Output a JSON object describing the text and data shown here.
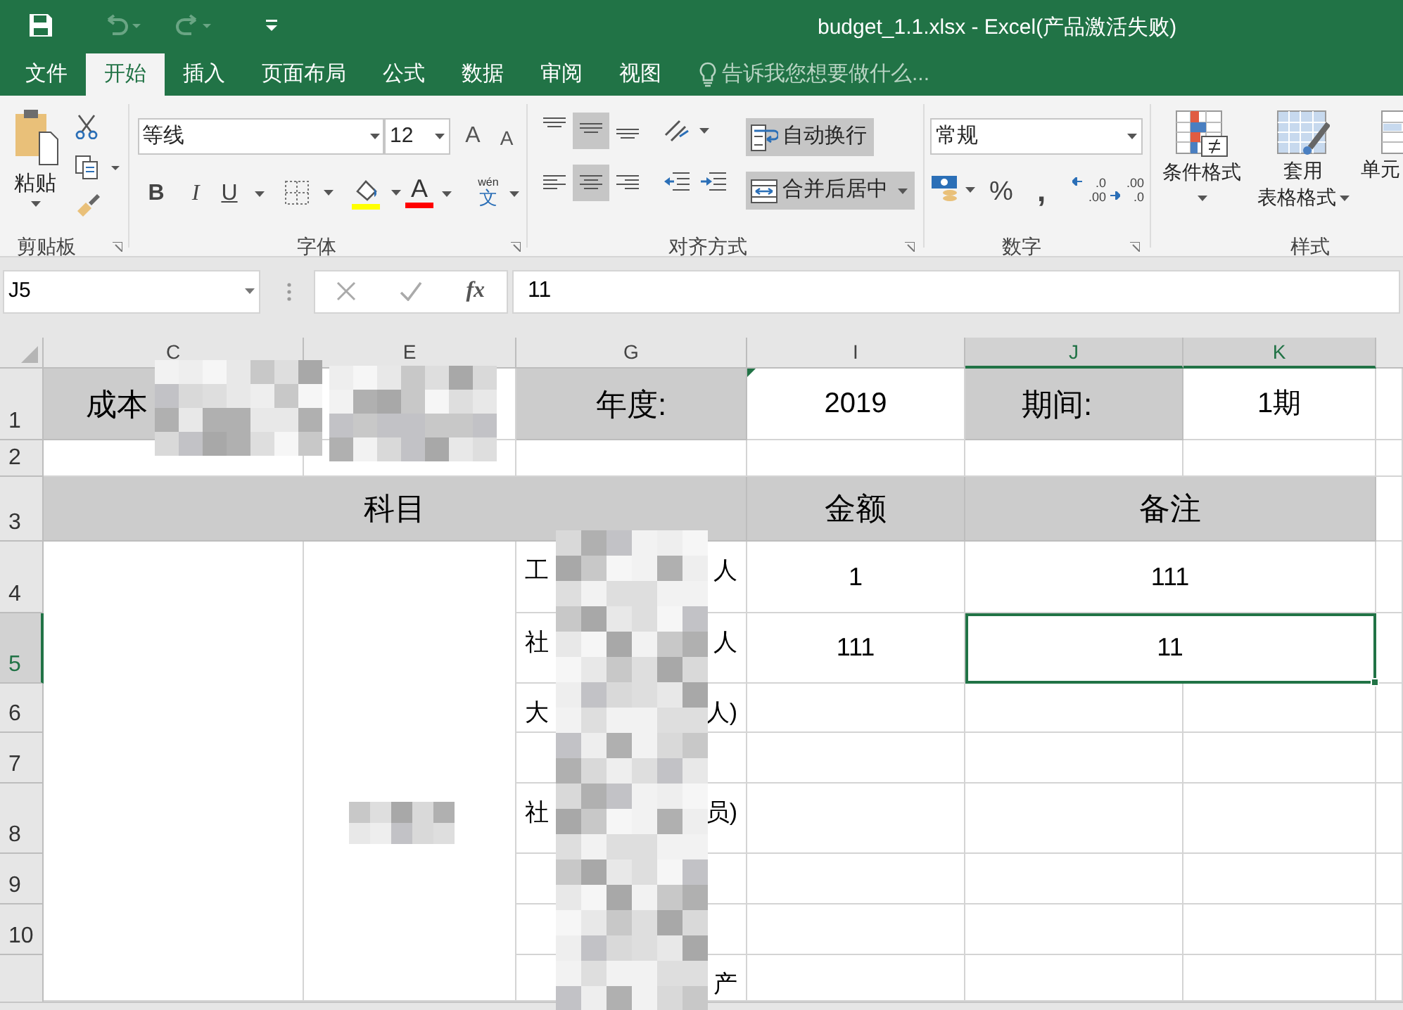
{
  "title_bar": {
    "title": "budget_1.1.xlsx - Excel(产品激活失败)"
  },
  "menu_tabs": [
    {
      "label": "文件",
      "selected": false
    },
    {
      "label": "开始",
      "selected": true
    },
    {
      "label": "插入",
      "selected": false
    },
    {
      "label": "页面布局",
      "selected": false
    },
    {
      "label": "公式",
      "selected": false
    },
    {
      "label": "数据",
      "selected": false
    },
    {
      "label": "审阅",
      "selected": false
    },
    {
      "label": "视图",
      "selected": false
    }
  ],
  "tell_me": {
    "placeholder": "告诉我您想要做什么..."
  },
  "ribbon": {
    "clipboard": {
      "paste": "粘贴",
      "label": "剪贴板"
    },
    "font": {
      "name": "等线",
      "size": "12",
      "grow": "A",
      "shrink": "A",
      "bold": "B",
      "italic": "I",
      "underline": "U",
      "font_color": "A",
      "phonetic_top": "wén",
      "phonetic_bottom": "文",
      "label": "字体"
    },
    "alignment": {
      "vertical": [
        {
          "selected": false
        },
        {
          "selected": true
        },
        {
          "selected": false
        }
      ],
      "horizontal": [
        {
          "selected": false
        },
        {
          "selected": true
        },
        {
          "selected": false
        }
      ],
      "wrap_text": {
        "label": "自动换行",
        "selected": true
      },
      "merge_center": {
        "label": "合并后居中",
        "selected": true
      },
      "label": "对齐方式"
    },
    "number": {
      "format": "常规",
      "percent": "%",
      "comma": ",",
      "decimals": [
        {
          "top": ".0",
          "bottom": ".00"
        },
        {
          "top": ".00",
          "bottom": ".0"
        }
      ],
      "label": "数字"
    },
    "styles": {
      "conditional": "条件格式",
      "table_lines": [
        "套用",
        "表格格式"
      ],
      "cell_styles": "单元",
      "label": "样式"
    }
  },
  "formula_bar": {
    "name_box": "J5",
    "fx": "fx",
    "value": "11"
  },
  "sheet": {
    "columns": [
      {
        "label": "C",
        "selected": false
      },
      {
        "label": "E",
        "selected": false
      },
      {
        "label": "G",
        "selected": false
      },
      {
        "label": "I",
        "selected": false
      },
      {
        "label": "J",
        "selected": true
      },
      {
        "label": "K",
        "selected": true
      }
    ],
    "rows": [
      {
        "label": "1",
        "selected": false
      },
      {
        "label": "2",
        "selected": false
      },
      {
        "label": "3",
        "selected": false
      },
      {
        "label": "4",
        "selected": false
      },
      {
        "label": "5",
        "selected": true
      },
      {
        "label": "6",
        "selected": false
      },
      {
        "label": "7",
        "selected": false
      },
      {
        "label": "8",
        "selected": false
      },
      {
        "label": "9",
        "selected": false
      },
      {
        "label": "10",
        "selected": false
      }
    ],
    "cells": [
      {
        "text": "成本",
        "shaded": true,
        "selected": false,
        "error_flag": false
      },
      {
        "text": "年度:",
        "shaded": true,
        "selected": false,
        "error_flag": false
      },
      {
        "text": "2019",
        "shaded": false,
        "selected": false,
        "error_flag": true
      },
      {
        "text": "期间:",
        "shaded": true,
        "selected": false,
        "error_flag": false
      },
      {
        "text": "1期",
        "shaded": false,
        "selected": false,
        "error_flag": false
      },
      {
        "text": "科目",
        "shaded": true,
        "selected": false,
        "error_flag": false
      },
      {
        "text": "金额",
        "shaded": true,
        "selected": false,
        "error_flag": false
      },
      {
        "text": "备注",
        "shaded": true,
        "selected": false,
        "error_flag": false
      },
      {
        "parts": [
          "工",
          "人"
        ],
        "shaded": false,
        "selected": false,
        "error_flag": false
      },
      {
        "text": "1",
        "shaded": false,
        "selected": false,
        "error_flag": false
      },
      {
        "text": "111",
        "shaded": false,
        "selected": false,
        "error_flag": false
      },
      {
        "parts": [
          "社",
          "人"
        ],
        "shaded": false,
        "selected": false,
        "error_flag": false
      },
      {
        "text": "111",
        "shaded": false,
        "selected": false,
        "error_flag": false
      },
      {
        "text": "11",
        "shaded": false,
        "selected": true,
        "error_flag": false
      },
      {
        "parts": [
          "大",
          "人)"
        ],
        "shaded": false,
        "selected": false,
        "error_flag": false
      },
      {
        "parts": [
          "社",
          "员)"
        ],
        "shaded": false,
        "selected": false,
        "error_flag": false
      },
      {
        "parts": [
          "产"
        ],
        "shaded": false,
        "selected": false,
        "error_flag": false
      }
    ]
  }
}
